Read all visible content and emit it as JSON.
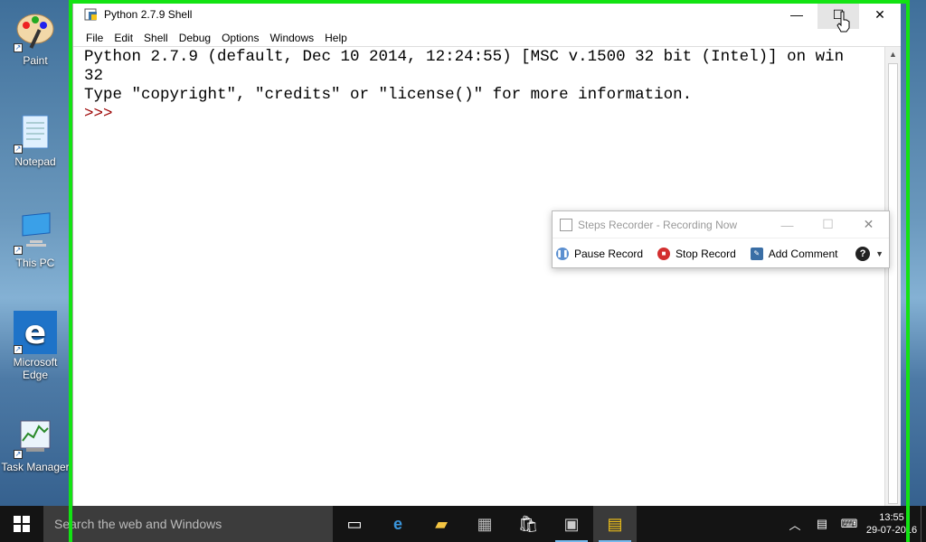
{
  "desktop": {
    "icons": [
      {
        "label": "Paint"
      },
      {
        "label": "Notepad"
      },
      {
        "label": "This PC"
      },
      {
        "label": "Microsoft Edge"
      },
      {
        "label": "Task Manager"
      }
    ]
  },
  "python_window": {
    "title": "Python 2.7.9 Shell",
    "menu": [
      "File",
      "Edit",
      "Shell",
      "Debug",
      "Options",
      "Windows",
      "Help"
    ],
    "shell_lines": [
      "Python 2.7.9 (default, Dec 10 2014, 12:24:55) [MSC v.1500 32 bit (Intel)] on win",
      "32",
      "Type \"copyright\", \"credits\" or \"license()\" for more information."
    ],
    "prompt": ">>> "
  },
  "steps_recorder": {
    "title": "Steps Recorder - Recording Now",
    "pause_label": "Pause Record",
    "stop_label": "Stop Record",
    "comment_label": "Add Comment"
  },
  "taskbar": {
    "search_placeholder": "Search the web and Windows",
    "time": "13:55",
    "date": "29-07-2016"
  },
  "colors": {
    "recording_frame": "#13e313",
    "prompt": "#9b0000",
    "taskbar": "#141414"
  }
}
